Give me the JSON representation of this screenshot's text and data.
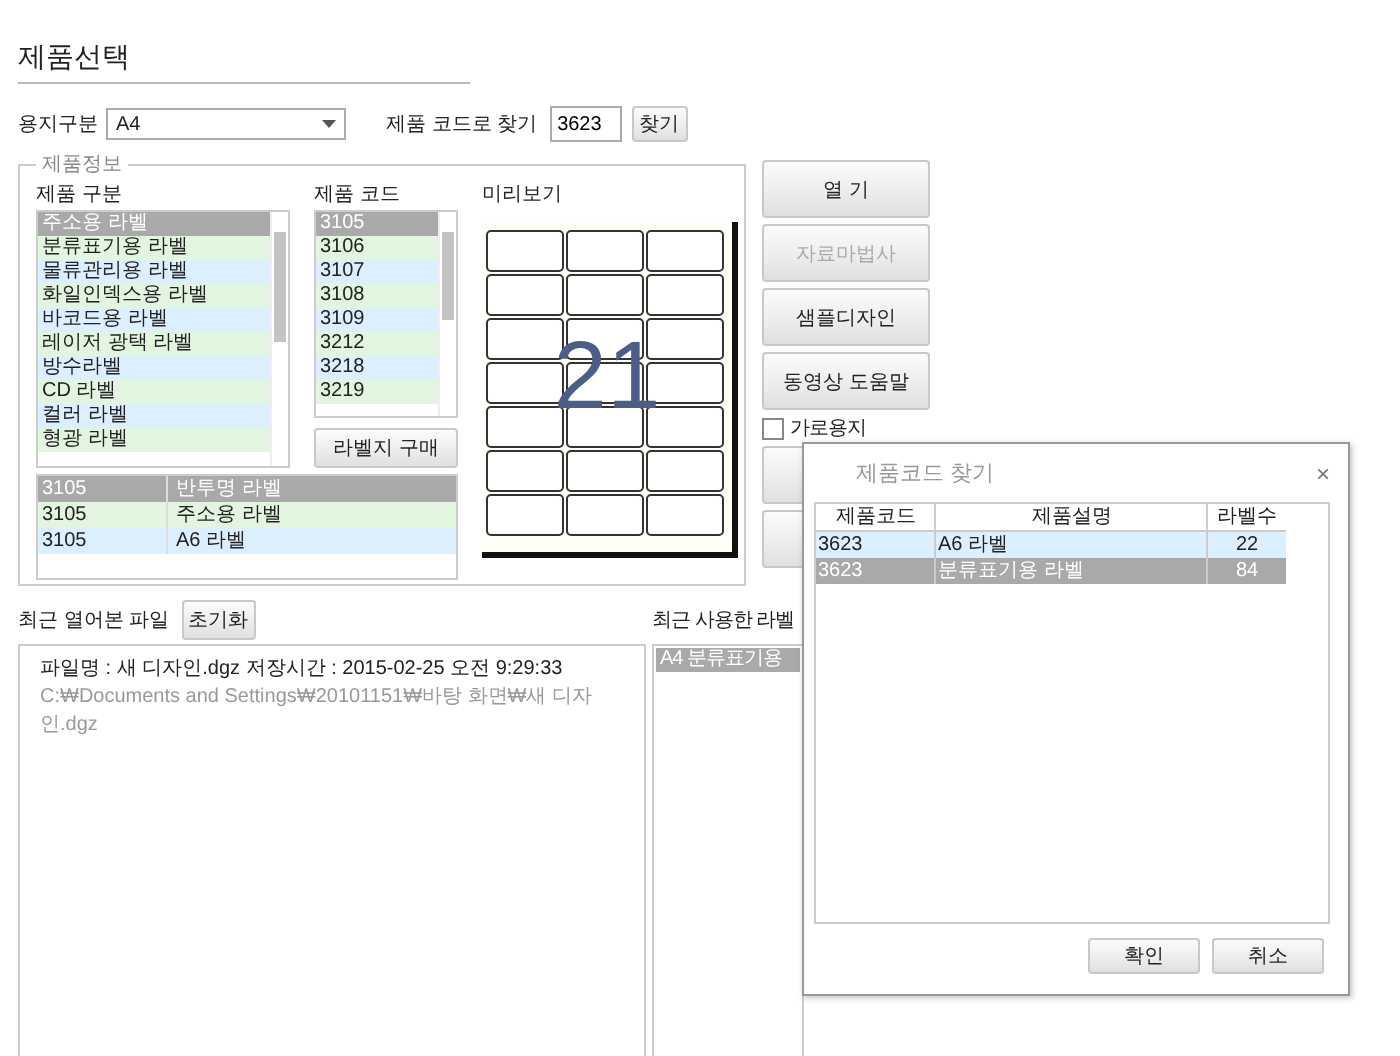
{
  "title": "제품선택",
  "paper": {
    "label": "용지구분",
    "value": "A4"
  },
  "code_search": {
    "label": "제품 코드로 찾기",
    "value": "3623",
    "button": "찾기"
  },
  "product_info": {
    "legend": "제품정보",
    "category_header": "제품 구분",
    "categories": [
      {
        "label": "주소용 라벨",
        "selected": true
      },
      {
        "label": "분류표기용 라벨",
        "selected": false
      },
      {
        "label": "물류관리용 라벨",
        "selected": false
      },
      {
        "label": "화일인덱스용 라벨",
        "selected": false
      },
      {
        "label": "바코드용 라벨",
        "selected": false
      },
      {
        "label": "레이저 광택 라벨",
        "selected": false
      },
      {
        "label": "방수라벨",
        "selected": false
      },
      {
        "label": "CD 라벨",
        "selected": false
      },
      {
        "label": "컬러 라벨",
        "selected": false
      },
      {
        "label": "형광 라벨",
        "selected": false
      }
    ],
    "code_header": "제품 코드",
    "codes": [
      {
        "label": "3105",
        "selected": true
      },
      {
        "label": "3106",
        "selected": false
      },
      {
        "label": "3107",
        "selected": false
      },
      {
        "label": "3108",
        "selected": false
      },
      {
        "label": "3109",
        "selected": false
      },
      {
        "label": "3212",
        "selected": false
      },
      {
        "label": "3218",
        "selected": false
      },
      {
        "label": "3219",
        "selected": false
      }
    ],
    "buy_button": "라벨지 구매",
    "matches": [
      {
        "code": "3105",
        "name": "반투명 라벨",
        "selected": true
      },
      {
        "code": "3105",
        "name": "주소용 라벨",
        "selected": false
      },
      {
        "code": "3105",
        "name": "A6 라벨",
        "selected": false
      }
    ],
    "preview_header": "미리보기",
    "preview_count": "21"
  },
  "actions": [
    {
      "label": "열 기",
      "disabled": false
    },
    {
      "label": "자료마법사",
      "disabled": true
    },
    {
      "label": "샘플디자인",
      "disabled": false
    },
    {
      "label": "동영상 도움말",
      "disabled": false
    }
  ],
  "landscape": {
    "label": "가로용지",
    "checked": false
  },
  "recent_files": {
    "label": "최근 열어본 파일",
    "reset_button": "초기화",
    "items": [
      {
        "info": "파일명 : 새 디자인.dgz   저장시간 : 2015-02-25 오전 9:29:33",
        "path": "C:₩Documents and Settings₩20101151₩바탕 화면₩새 디자인.dgz"
      }
    ]
  },
  "recent_labels": {
    "label": "최근 사용한 라벨",
    "items": [
      {
        "label": "A4 분류표기용",
        "selected": true
      }
    ]
  },
  "dialog": {
    "title": "제품코드 찾기",
    "close": "×",
    "columns": [
      "제품코드",
      "제품설명",
      "라벨수"
    ],
    "rows": [
      {
        "code": "3623",
        "description": "A6 라벨",
        "count": "22",
        "selected": false
      },
      {
        "code": "3623",
        "description": "분류표기용 라벨",
        "count": "84",
        "selected": true
      }
    ],
    "buttons": [
      "확인",
      "취소"
    ]
  }
}
